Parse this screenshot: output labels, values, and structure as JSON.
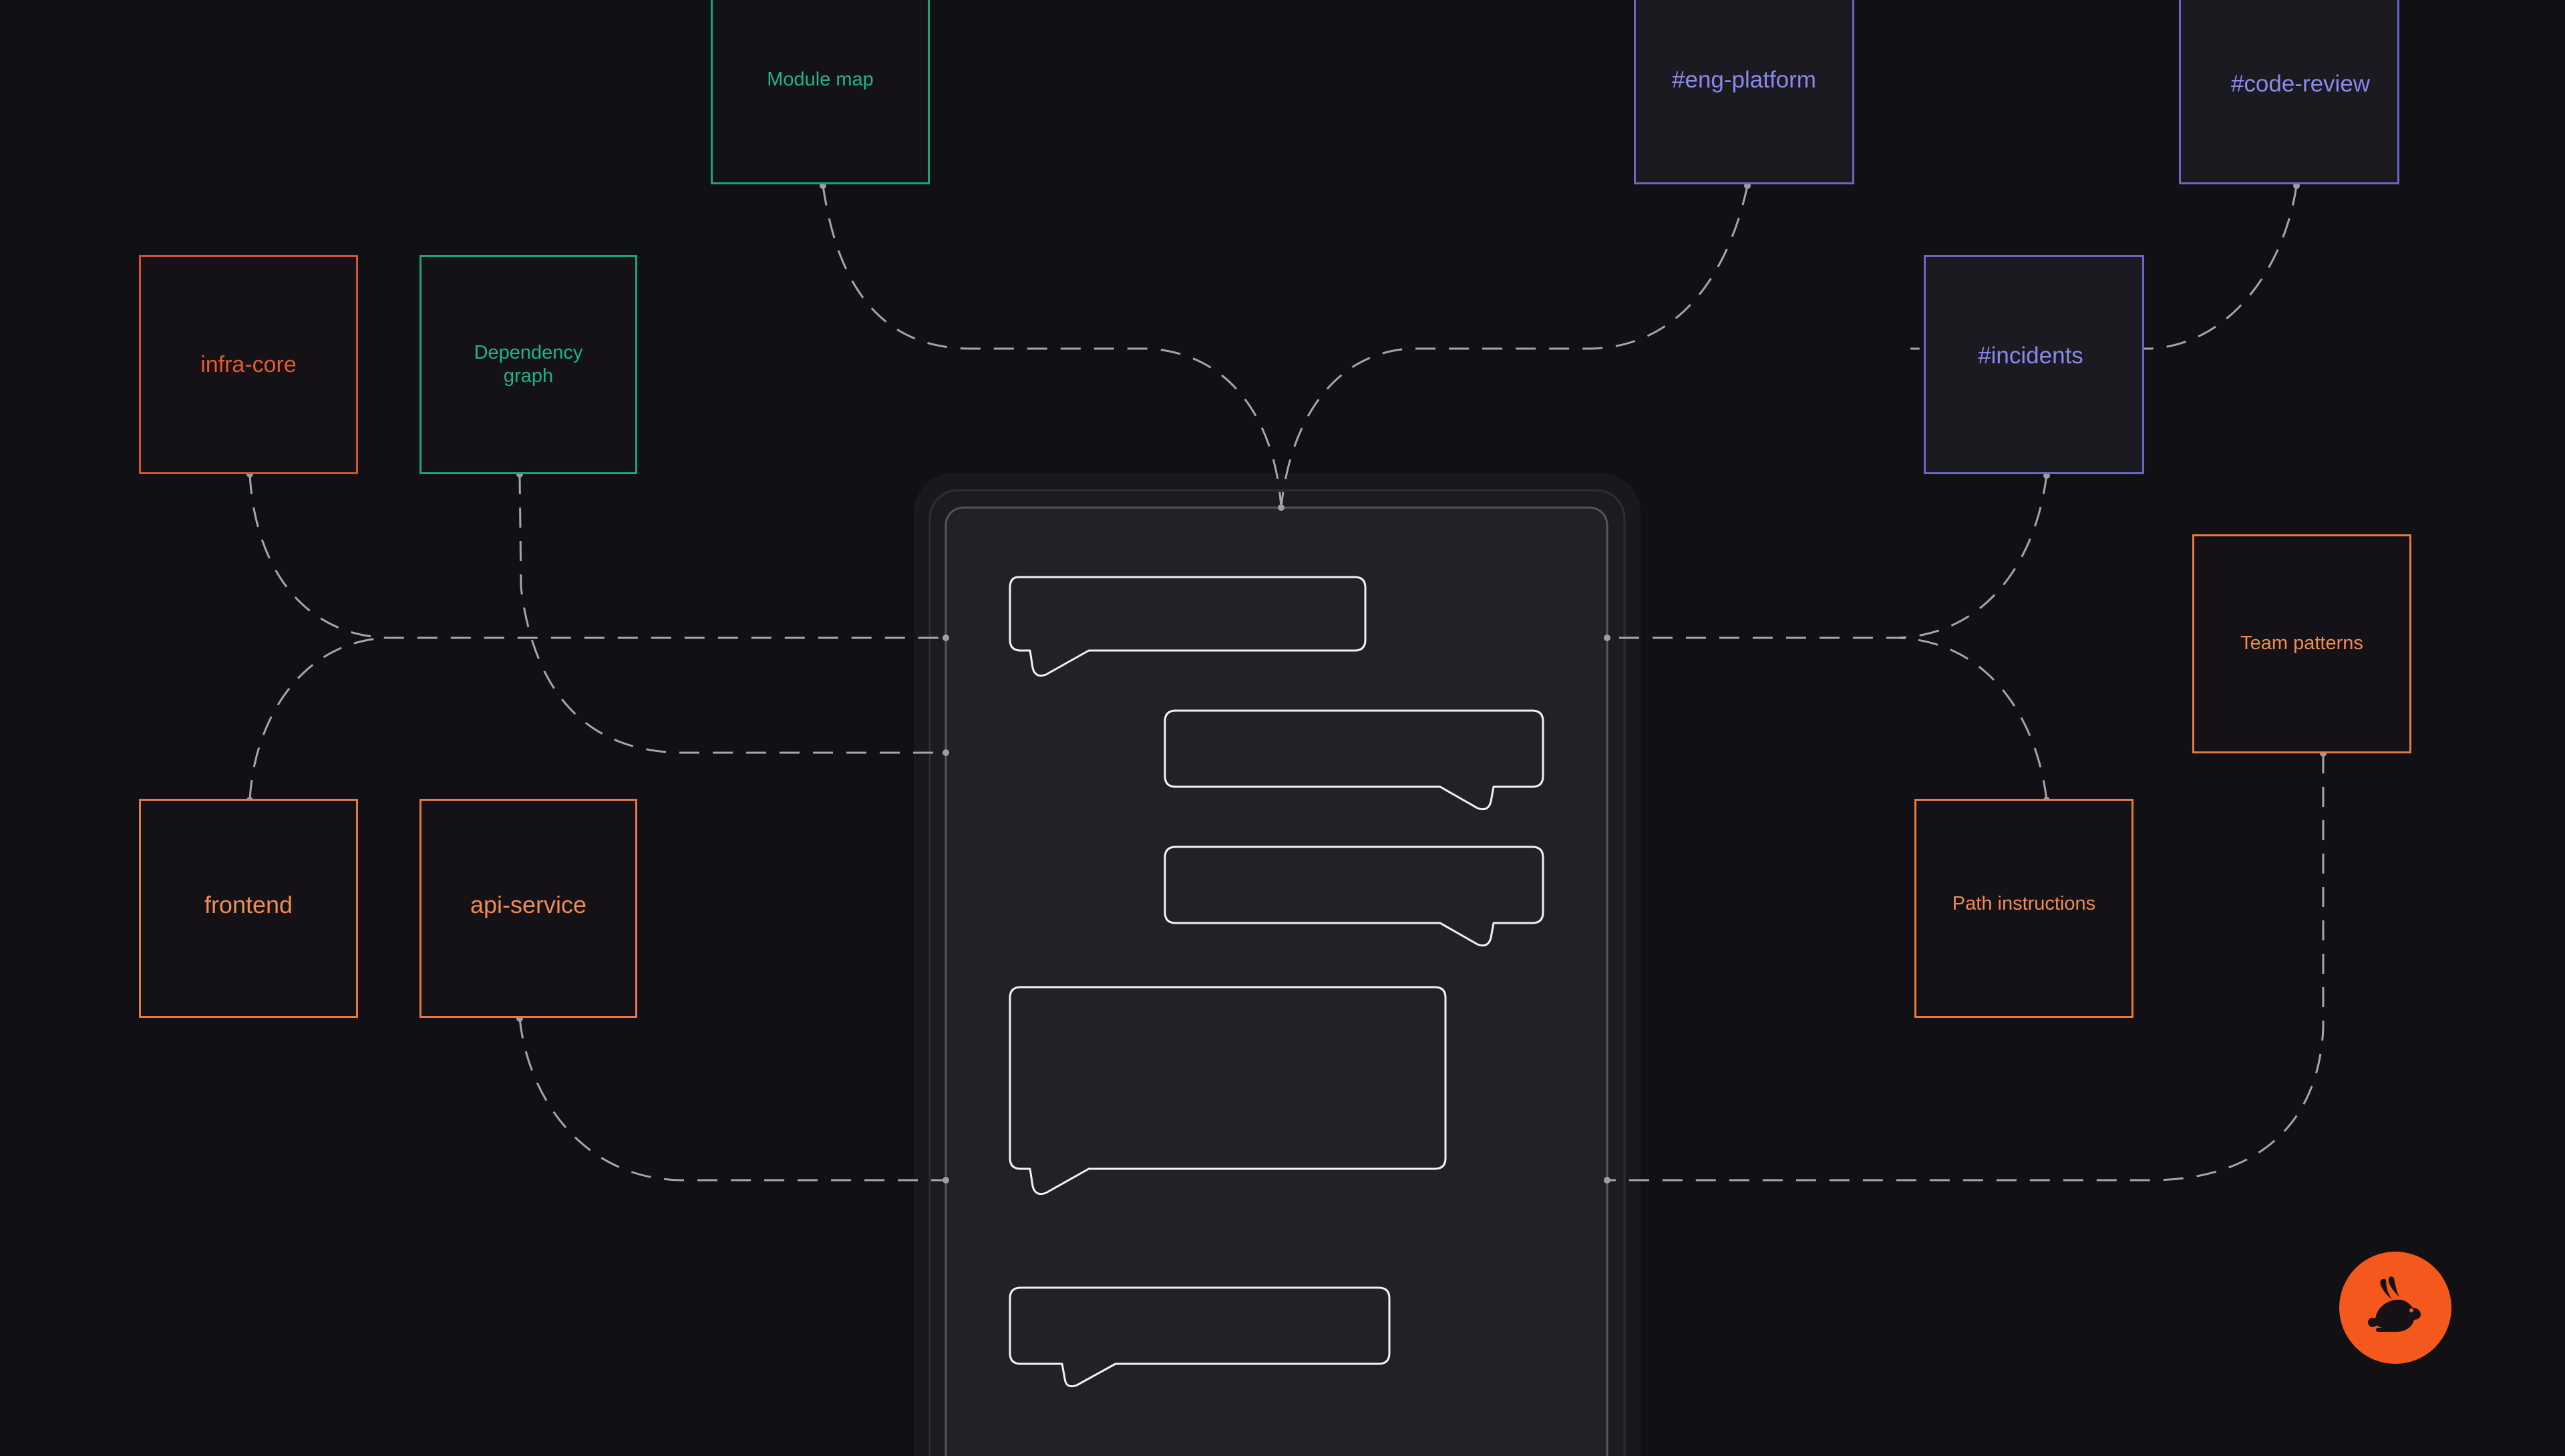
{
  "colors": {
    "background": "#111014",
    "connector": "#a6a4ad",
    "repo_red": "#e15b33",
    "repo_orange": "#f08b52",
    "docs_green": "#1fb486",
    "channel_purple": "#8a88ea",
    "logo": "#f5581d"
  },
  "nodes": {
    "infra_core": "infra-core",
    "dependency_graph": "Dependency\ngraph",
    "module_map": "Module map",
    "eng_platform": "#eng-platform",
    "code_review": "#code-review",
    "incidents": "#incidents",
    "team_patterns": "Team patterns",
    "frontend": "frontend",
    "api_service": "api-service",
    "path_instructions": "Path instructions"
  },
  "chat_panel": {
    "bubble_count": 5
  },
  "logo": {
    "icon": "rabbit-icon"
  }
}
